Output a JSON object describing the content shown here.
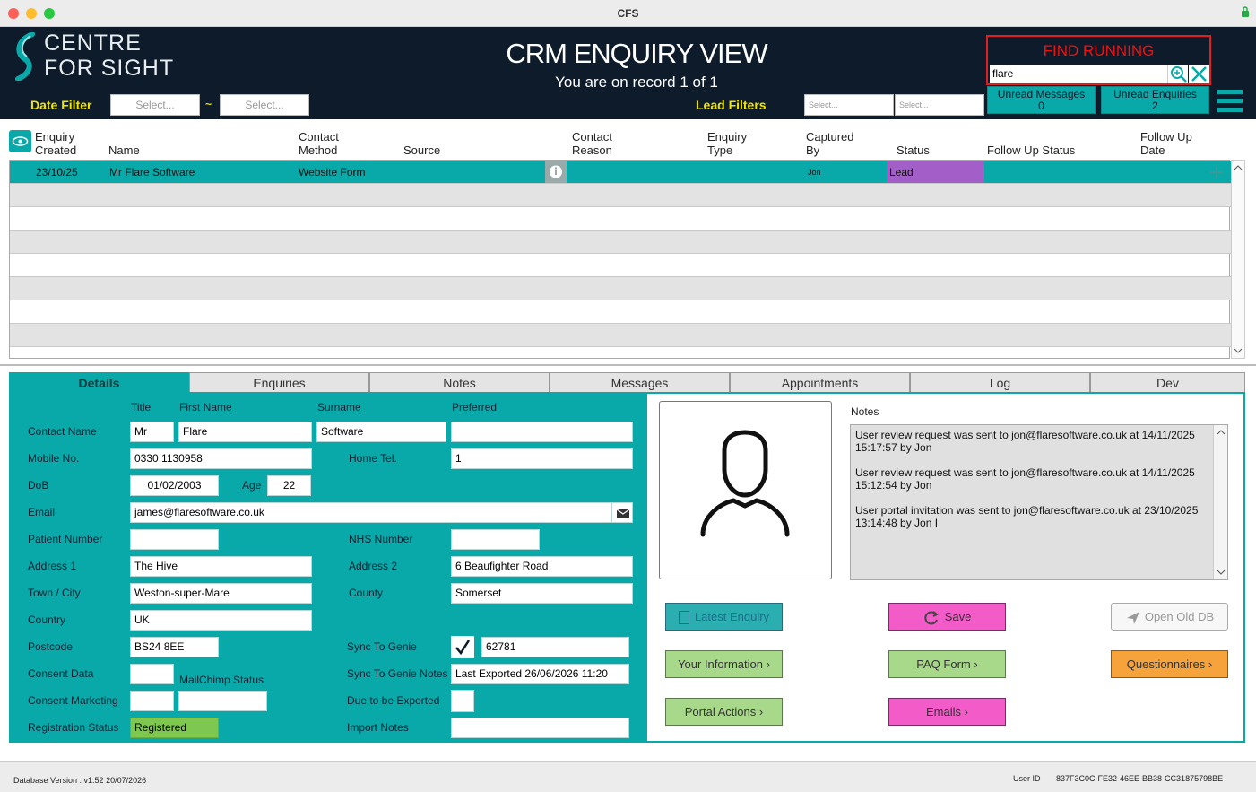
{
  "window": {
    "title": "CFS"
  },
  "header": {
    "logo_line1": "CENTRE",
    "logo_line2": "FOR SIGHT",
    "title": "CRM ENQUIRY VIEW",
    "record_info": "You are on record 1 of 1",
    "date_filter_label": "Date Filter",
    "date_from_placeholder": "Select...",
    "date_sep": "~",
    "date_to_placeholder": "Select...",
    "lead_filters_label": "Lead Filters",
    "lead_filter1_placeholder": "Select...",
    "lead_filter2_placeholder": "Select...",
    "find_label": "FIND RUNNING",
    "find_value": "flare",
    "unread_messages_label": "Unread Messages",
    "unread_messages_count": "0",
    "unread_enquiries_label": "Unread Enquiries",
    "unread_enquiries_count": "2"
  },
  "list": {
    "columns": {
      "enquiry_created_1": "Enquiry",
      "enquiry_created_2": "Created",
      "name": "Name",
      "contact_method_1": "Contact",
      "contact_method_2": "Method",
      "source": "Source",
      "contact_reason_1": "Contact",
      "contact_reason_2": "Reason",
      "enquiry_type_1": "Enquiry",
      "enquiry_type_2": "Type",
      "captured_by_1": "Captured",
      "captured_by_2": "By",
      "status": "Status",
      "follow_up_status": "Follow Up Status",
      "follow_up_date_1": "Follow Up",
      "follow_up_date_2": "Date"
    },
    "rows": [
      {
        "created": "23/10/25",
        "name": "Mr Flare Software",
        "method": "Website Form",
        "captured_by": "Jon",
        "status": "Lead"
      }
    ]
  },
  "tabs": [
    "Details",
    "Enquiries",
    "Notes",
    "Messages",
    "Appointments",
    "Log",
    "Dev"
  ],
  "details": {
    "hdr_title": "Title",
    "hdr_first": "First Name",
    "hdr_surname": "Surname",
    "hdr_preferred": "Preferred",
    "contact_name_label": "Contact Name",
    "title": "Mr",
    "first_name": "Flare",
    "surname": "Software",
    "preferred": "",
    "mobile_label": "Mobile No.",
    "mobile": "0330 1130958",
    "home_tel_label": "Home Tel.",
    "home_tel": "1",
    "dob_label": "DoB",
    "dob": "01/02/2003",
    "age_label": "Age",
    "age": "22",
    "email_label": "Email",
    "email": "james@flaresoftware.co.uk",
    "patient_number_label": "Patient Number",
    "patient_number": "",
    "nhs_number_label": "NHS Number",
    "nhs_number": "",
    "address1_label": "Address 1",
    "address1": "The Hive",
    "address2_label": "Address 2",
    "address2": "6 Beaufighter Road",
    "town_label": "Town / City",
    "town": "Weston-super-Mare",
    "county_label": "County",
    "county": "Somerset",
    "country_label": "Country",
    "country": "UK",
    "postcode_label": "Postcode",
    "postcode": "BS24 8EE",
    "sync_genie_label": "Sync To Genie",
    "sync_genie_id": "62781",
    "consent_data_label": "Consent Data",
    "mailchimp_label": "MailChimp Status",
    "sync_notes_label": "Sync To Genie Notes",
    "sync_notes": "Last Exported 26/06/2026 11:20",
    "consent_marketing_label": "Consent Marketing",
    "due_export_label": "Due to be Exported",
    "registration_label": "Registration Status",
    "registration": "Registered",
    "import_notes_label": "Import Notes",
    "import_notes": ""
  },
  "notes_panel": {
    "label": "Notes",
    "line1a": "User review request was sent to jon@flaresoftware.co.uk at 14/11/2025",
    "line1b": "15:17:57 by Jon",
    "line2a": "User review request was sent to jon@flaresoftware.co.uk at 14/11/2025",
    "line2b": "15:12:54 by Jon",
    "line3a": "User portal invitation was sent to jon@flaresoftware.co.uk at 23/10/2025",
    "line3b": "13:14:48 by Jon I"
  },
  "buttons": {
    "latest_enquiry": "Latest Enquiry",
    "save": "Save",
    "open_old_db": "Open Old DB",
    "your_information": "Your Information",
    "paq_form": "PAQ Form",
    "questionnaires": "Questionnaires",
    "portal_actions": "Portal Actions",
    "emails": "Emails"
  },
  "footer": {
    "db_version": "Database Version : v1.52 20/07/2026",
    "user_id_label": "User ID",
    "user_id": "837F3C0C-FE32-46EE-BB38-CC31875798BE"
  },
  "colors": {
    "teal": "#0aa9a9",
    "navy": "#0d1b2a",
    "lead_purple": "#a35fc8",
    "pink": "#f25bc8",
    "green_btn": "#a8d98a",
    "orange": "#f5a33a",
    "registered_green": "#7ec84f"
  }
}
